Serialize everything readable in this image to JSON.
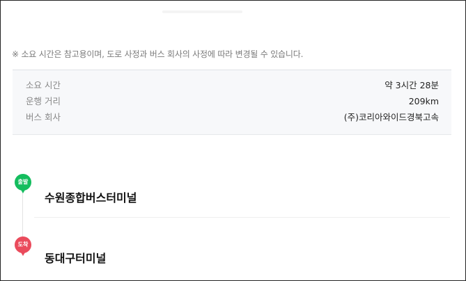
{
  "notice": "※ 소요 시간은 참고용이며, 도로 사정과 버스 회사의 사정에 따라 변경될 수 있습니다.",
  "info": {
    "rows": [
      {
        "label": "소요 시간",
        "value": "약 3시간 28분"
      },
      {
        "label": "운행 거리",
        "value": "209km"
      },
      {
        "label": "버스 회사",
        "value": "(주)코리아와이드경북고속"
      }
    ]
  },
  "route": {
    "start": {
      "badge": "출발",
      "name": "수원종합버스터미널",
      "color": "#14bd5e"
    },
    "end": {
      "badge": "도착",
      "name": "동대구터미널",
      "color": "#ea4b5c"
    }
  }
}
